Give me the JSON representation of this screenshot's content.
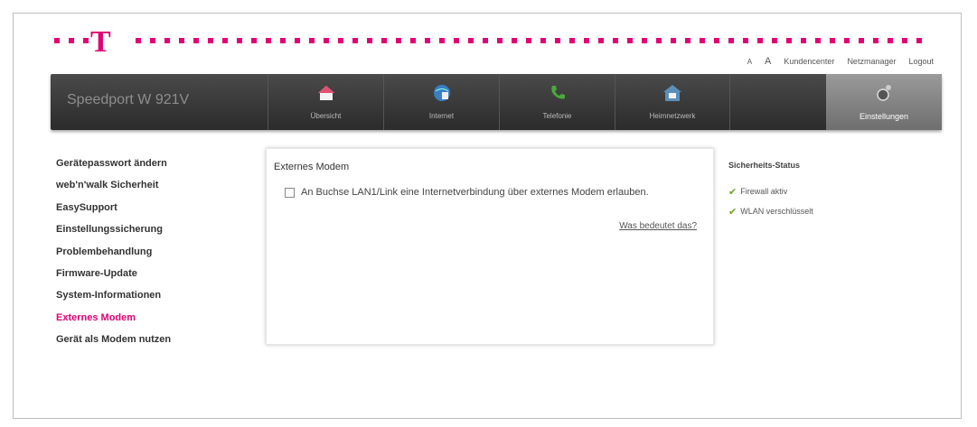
{
  "brand": {
    "logo_letter": "T",
    "logo_color": "#e20074",
    "product_name": "Speedport W 921V"
  },
  "top_links": {
    "font_small": "A",
    "font_large": "A",
    "customer_center": "Kundencenter",
    "network_manager": "Netzmanager",
    "logout": "Logout"
  },
  "nav": {
    "items": [
      {
        "label": "Übersicht",
        "icon": "house-icon"
      },
      {
        "label": "Internet",
        "icon": "globe-icon"
      },
      {
        "label": "Telefonie",
        "icon": "phone-icon"
      },
      {
        "label": "Heimnetzwerk",
        "icon": "home-network-icon"
      }
    ],
    "active": {
      "label": "Einstellungen",
      "icon": "settings-knob-icon"
    }
  },
  "sidebar": {
    "items": [
      {
        "label": "Gerätepasswort ändern",
        "active": false
      },
      {
        "label": "web'n'walk Sicherheit",
        "active": false
      },
      {
        "label": "EasySupport",
        "active": false
      },
      {
        "label": "Einstellungssicherung",
        "active": false
      },
      {
        "label": "Problembehandlung",
        "active": false
      },
      {
        "label": "Firmware-Update",
        "active": false
      },
      {
        "label": "System-Informationen",
        "active": false
      },
      {
        "label": "Externes Modem",
        "active": true
      },
      {
        "label": "Gerät als Modem nutzen",
        "active": false
      }
    ]
  },
  "main": {
    "title": "Externes Modem",
    "checkbox_label": "An Buchse LAN1/Link eine Internetverbindung über externes Modem erlauben.",
    "checkbox_checked": false,
    "help_link": "Was bedeutet das?"
  },
  "status": {
    "title": "Sicherheits-Status",
    "items": [
      {
        "label": "Firewall aktiv",
        "icon": "check-icon"
      },
      {
        "label": "WLAN verschlüsselt",
        "icon": "check-icon"
      }
    ]
  },
  "colors": {
    "accent": "#e20074",
    "ok_green": "#6aa620"
  }
}
